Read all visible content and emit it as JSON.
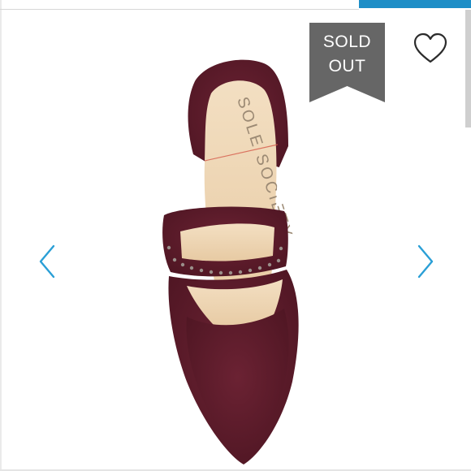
{
  "badge": {
    "line1": "SOLD",
    "line2": "OUT",
    "color": "#666666"
  },
  "icons": {
    "favorite": "heart-outline-icon",
    "previous": "chevron-left-icon",
    "next": "chevron-right-icon"
  },
  "product_image": {
    "description_brand_insole": "SOLE SOCIETY",
    "color": "#5c1a2a",
    "insole_color": "#f0d9b8"
  },
  "colors": {
    "accent": "#1e8ec7",
    "arrow": "#2a9fd6"
  }
}
